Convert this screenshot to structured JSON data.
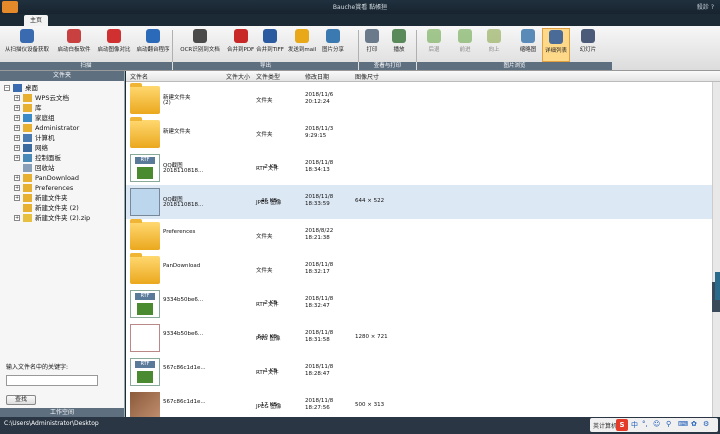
{
  "window": {
    "title": "Bauche賞看 黏帳狟",
    "help": "殺診 ?"
  },
  "tabs": [
    {
      "label": "主页"
    }
  ],
  "ribbon": {
    "buttons": [
      {
        "label": "从扫描仪设备获取",
        "icon": "scanner-icon",
        "color": "#3a6ab0",
        "selected": false,
        "disabled": false
      },
      {
        "label": "启动白板软件",
        "icon": "whiteboard-icon",
        "color": "#c84040",
        "selected": false,
        "disabled": false
      },
      {
        "label": "启动图像对比",
        "icon": "compare-icon",
        "color": "#d03030",
        "selected": false,
        "disabled": false
      },
      {
        "label": "启动翻台程序",
        "icon": "program-icon",
        "color": "#2a6ab8",
        "selected": false,
        "disabled": false
      },
      {
        "label": "OCR识别到文档",
        "icon": "ocr-icon",
        "color": "#4a4a4a",
        "selected": false,
        "disabled": false
      },
      {
        "label": "合并到PDF",
        "icon": "pdf-icon",
        "color": "#c82828",
        "selected": false,
        "disabled": false
      },
      {
        "label": "合并到TIFF",
        "icon": "tiff-icon",
        "color": "#2a5aa0",
        "selected": false,
        "disabled": false
      },
      {
        "label": "发送到mail",
        "icon": "mail-icon",
        "color": "#e8a818",
        "selected": false,
        "disabled": false
      },
      {
        "label": "图片分享",
        "icon": "share-icon",
        "color": "#3a7ab0",
        "selected": false,
        "disabled": false
      },
      {
        "label": "打印",
        "icon": "print-icon",
        "color": "#6a7a8a",
        "selected": false,
        "disabled": false
      },
      {
        "label": "播放",
        "icon": "play-icon",
        "color": "#5a8a5a",
        "selected": false,
        "disabled": false
      },
      {
        "label": "后退",
        "icon": "back-icon",
        "color": "#6aa84a",
        "selected": false,
        "disabled": true
      },
      {
        "label": "前进",
        "icon": "forward-icon",
        "color": "#6aa84a",
        "selected": false,
        "disabled": true
      },
      {
        "label": "向上",
        "icon": "up-icon",
        "color": "#8aa84a",
        "selected": false,
        "disabled": true
      },
      {
        "label": "缩略图",
        "icon": "thumbnail-icon",
        "color": "#5a8ab8",
        "selected": false,
        "disabled": false
      },
      {
        "label": "详细列表",
        "icon": "detail-list-icon",
        "color": "#4a6a98",
        "selected": true,
        "disabled": false
      },
      {
        "label": "幻灯片",
        "icon": "slideshow-icon",
        "color": "#4a5a78",
        "selected": false,
        "disabled": false
      }
    ],
    "groups": [
      {
        "label": "扫描"
      },
      {
        "label": "导出"
      },
      {
        "label": "查看与打印"
      },
      {
        "label": "图片浏览"
      }
    ]
  },
  "left_panel": {
    "header": "文件夹",
    "tree": [
      {
        "label": "桌面",
        "expander": "−",
        "icon": "desktop-icon",
        "icon_color": "#3a6ab0",
        "level": 0
      },
      {
        "label": "WPS云文档",
        "expander": "+",
        "icon": "folder-icon",
        "icon_color": "#e8b030",
        "level": 1
      },
      {
        "label": "库",
        "expander": "+",
        "icon": "library-icon",
        "icon_color": "#e8b030",
        "level": 1
      },
      {
        "label": "家庭组",
        "expander": "+",
        "icon": "homegroup-icon",
        "icon_color": "#3a8ac8",
        "level": 1
      },
      {
        "label": "Administrator",
        "expander": "+",
        "icon": "user-folder-icon",
        "icon_color": "#e8b030",
        "level": 1
      },
      {
        "label": "计算机",
        "expander": "+",
        "icon": "computer-icon",
        "icon_color": "#4a7ab0",
        "level": 1
      },
      {
        "label": "网络",
        "expander": "+",
        "icon": "network-icon",
        "icon_color": "#3a6aa0",
        "level": 1
      },
      {
        "label": "控制面板",
        "expander": "+",
        "icon": "control-panel-icon",
        "icon_color": "#4a8ab8",
        "level": 1
      },
      {
        "label": "回收站",
        "expander": "",
        "icon": "recycle-bin-icon",
        "icon_color": "#8aa0b8",
        "level": 1
      },
      {
        "label": "PanDownload",
        "expander": "+",
        "icon": "folder-icon",
        "icon_color": "#e8b030",
        "level": 1
      },
      {
        "label": "Preferences",
        "expander": "+",
        "icon": "folder-icon",
        "icon_color": "#e8b030",
        "level": 1
      },
      {
        "label": "新建文件夹",
        "expander": "+",
        "icon": "folder-icon",
        "icon_color": "#e8b030",
        "level": 1
      },
      {
        "label": "新建文件夹 (2)",
        "expander": "",
        "icon": "folder-icon",
        "icon_color": "#e8b030",
        "level": 1
      },
      {
        "label": "新建文件夹 (2).zip",
        "expander": "+",
        "icon": "zip-folder-icon",
        "icon_color": "#e8c040",
        "level": 1
      }
    ],
    "search_label": "输入文件名中的关键字:",
    "search_value": "",
    "search_button": "查找",
    "footer": "工作空间"
  },
  "columns": {
    "name": "文件名",
    "size": "文件大小",
    "type": "文件类型",
    "modified": "修改日期",
    "dimensions": "图像尺寸"
  },
  "files": [
    {
      "name": "新建文件夹",
      "name2": "(2)",
      "size": "",
      "type": "文件夹",
      "date": "2018/11/6",
      "time": "20:12:24",
      "dims": "",
      "thumb": "folder",
      "selected": false
    },
    {
      "name": "新建文件夹",
      "name2": "",
      "size": "",
      "type": "文件夹",
      "date": "2018/11/3",
      "time": "9:29:15",
      "dims": "",
      "thumb": "folder",
      "selected": false
    },
    {
      "name": "QQ截图",
      "name2": "2018110818...",
      "size": "2 KB",
      "type": "RTF 文件",
      "date": "2018/11/8",
      "time": "18:34:13",
      "dims": "",
      "thumb": "rtf",
      "selected": false
    },
    {
      "name": "QQ截图",
      "name2": "2018110818...",
      "size": "46 KB",
      "type": "JPEG 图像",
      "date": "2018/11/8",
      "time": "18:33:59",
      "dims": "644 × 522",
      "thumb": "jpeg-grid",
      "selected": true
    },
    {
      "name": "Preferences",
      "name2": "",
      "size": "",
      "type": "文件夹",
      "date": "2018/8/22",
      "time": "18:21:38",
      "dims": "",
      "thumb": "folder",
      "selected": false
    },
    {
      "name": "PanDownload",
      "name2": "",
      "size": "",
      "type": "文件夹",
      "date": "2018/11/8",
      "time": "18:32:17",
      "dims": "",
      "thumb": "folder",
      "selected": false
    },
    {
      "name": "9334b50be6...",
      "name2": "",
      "size": "2 KB",
      "type": "RTF 文件",
      "date": "2018/11/8",
      "time": "18:32:47",
      "dims": "",
      "thumb": "rtf",
      "selected": false
    },
    {
      "name": "9334b50be6...",
      "name2": "",
      "size": "840 KB",
      "type": "PNG 图像",
      "date": "2018/11/8",
      "time": "18:31:58",
      "dims": "1280 × 721",
      "thumb": "png-card",
      "selected": false
    },
    {
      "name": "567c86c1d1e...",
      "name2": "",
      "size": "1 KB",
      "type": "RTF 文件",
      "date": "2018/11/8",
      "time": "18:28:47",
      "dims": "",
      "thumb": "rtf",
      "selected": false
    },
    {
      "name": "567c86c1d1e...",
      "name2": "",
      "size": "17 KB",
      "type": "JPEG 图像",
      "date": "2018/11/8",
      "time": "18:27:56",
      "dims": "500 × 313",
      "thumb": "photo",
      "selected": false
    }
  ],
  "status": {
    "path": "C:\\Users\\Administrator\\Desktop",
    "ime_label": "英计算机"
  },
  "ime": {
    "glyphs": [
      "中",
      "°,",
      "☺",
      "⚲",
      "⌨",
      "✿",
      "⚙"
    ]
  }
}
